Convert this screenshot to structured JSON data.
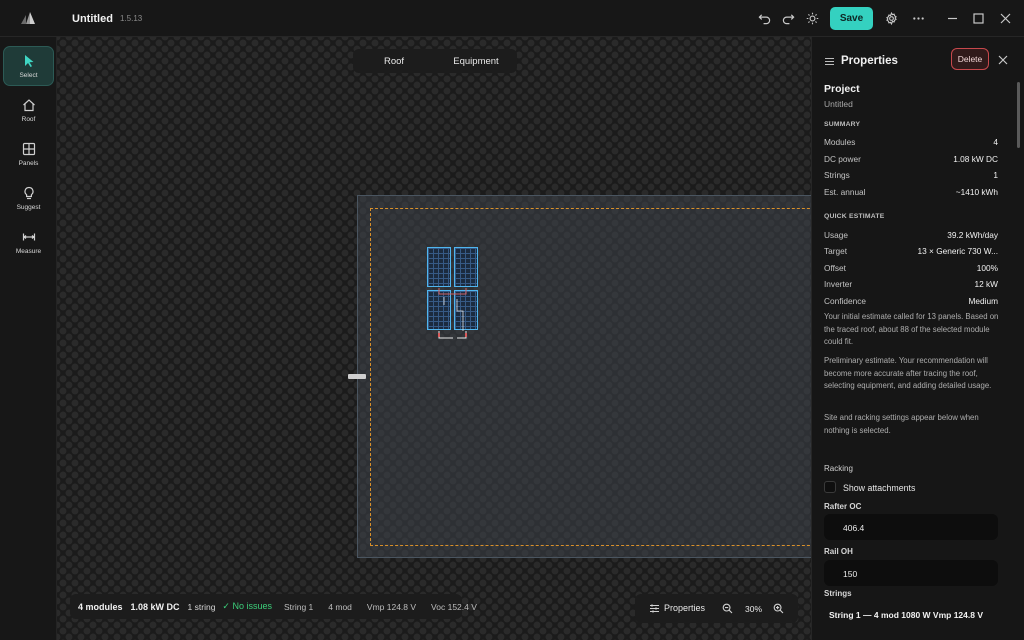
{
  "window": {
    "title": "Untitled",
    "version": "1.5.13",
    "save_label": "Save"
  },
  "icons": {
    "undo": "undo-icon",
    "redo": "redo-icon",
    "theme": "sun-icon",
    "settings": "gear-icon",
    "more": "more-horizontal-icon",
    "minimize": "minimize-icon",
    "maximize": "maximize-icon",
    "close": "close-icon"
  },
  "tools": [
    {
      "label": "Select",
      "icon": "cursor-icon",
      "active": true
    },
    {
      "label": "Roof",
      "icon": "home-icon"
    },
    {
      "label": "Panels",
      "icon": "grid-icon"
    },
    {
      "label": "Suggest",
      "icon": "lightbulb-icon"
    },
    {
      "label": "Measure",
      "icon": "ruler-icon"
    }
  ],
  "canvas": {
    "tabs": [
      "Roof",
      "Equipment"
    ],
    "status": {
      "modules": "4 modules",
      "power": "1.08 kW DC",
      "strings": "1 string",
      "issues": "✓ No issues",
      "string_name": "String 1",
      "string_mod": "4 mod",
      "vmp": "Vmp 124.8 V",
      "voc": "Voc 152.4 V"
    },
    "zoom": {
      "properties_label": "Properties",
      "level": "30%"
    }
  },
  "props": {
    "title": "Properties",
    "delete_label": "Delete",
    "project_heading": "Project",
    "project_name": "Untitled",
    "summary_heading": "SUMMARY",
    "summary": [
      {
        "k": "Modules",
        "v": "4"
      },
      {
        "k": "DC power",
        "v": "1.08 kW DC"
      },
      {
        "k": "Strings",
        "v": "1"
      },
      {
        "k": "Est. annual",
        "v": "~1410 kWh"
      }
    ],
    "quick_heading": "QUICK ESTIMATE",
    "quick": [
      {
        "k": "Usage",
        "v": "39.2 kWh/day"
      },
      {
        "k": "Target",
        "v": "13 × Generic 730 W..."
      },
      {
        "k": "Offset",
        "v": "100%"
      },
      {
        "k": "Inverter",
        "v": "12 kW"
      },
      {
        "k": "Confidence",
        "v": "Medium"
      }
    ],
    "note1": "Your initial estimate called for 13 panels. Based on the traced roof, about 88 of the selected module could fit.",
    "note2": "Preliminary estimate. Your recommendation will become more accurate after tracing the roof, selecting equipment, and adding detailed usage.",
    "note3": "Site and racking settings appear below when nothing is selected.",
    "racking_heading": "Racking",
    "show_attachments": "Show attachments",
    "rafter_label": "Rafter OC",
    "rafter_value": "406.4",
    "rail_label": "Rail OH",
    "rail_value": "150",
    "strings_heading": "Strings",
    "string_summary": "String 1  —  4 mod  1080 W  Vmp 124.8 V"
  },
  "colors": {
    "accent": "#34d1c0",
    "danger": "#c7484c",
    "panel_outline": "#4fb6ef",
    "setback": "#d9902a",
    "ok": "#3ccf7a"
  }
}
